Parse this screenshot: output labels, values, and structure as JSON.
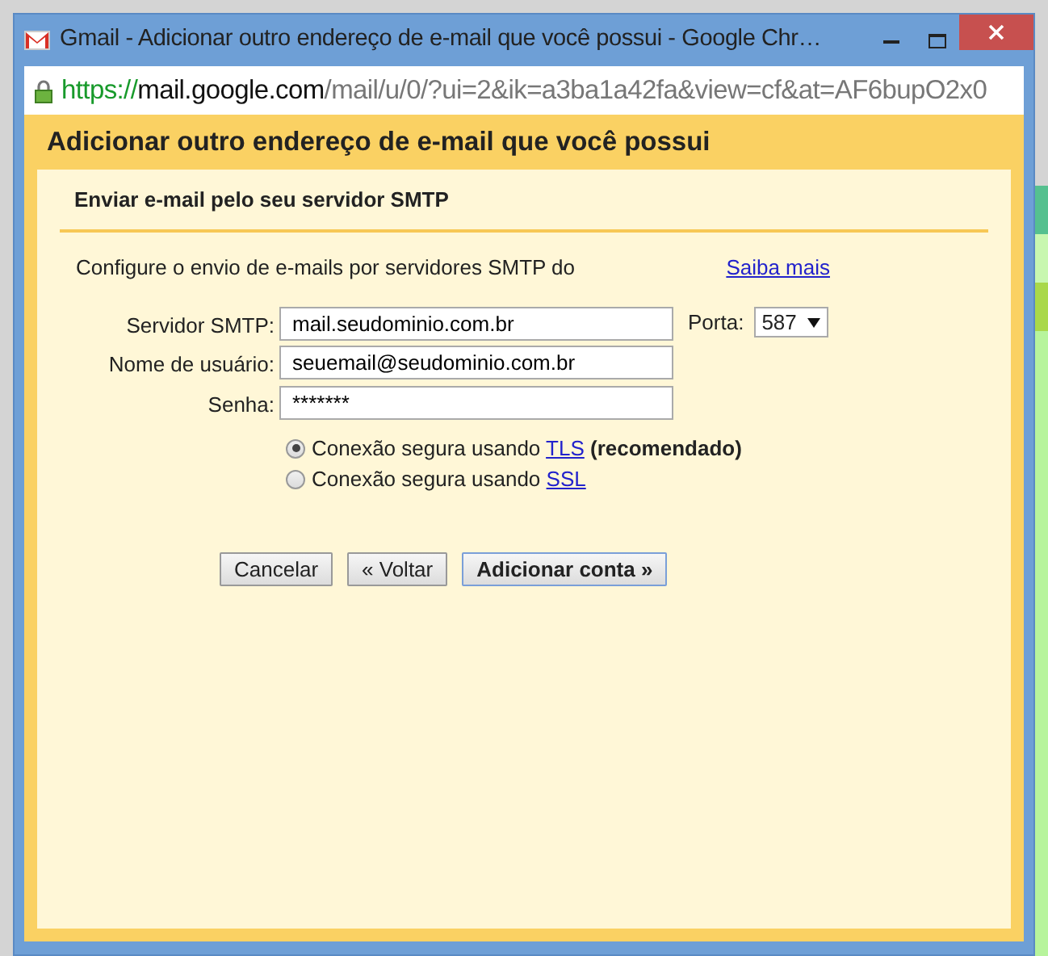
{
  "window": {
    "title": "Gmail - Adicionar outro endereço de e-mail que você possui - Google Chr…"
  },
  "address_bar": {
    "scheme": "https://",
    "host": "mail.google.com",
    "path": "/mail/u/0/?ui=2&ik=a3ba1a42fa&view=cf&at=AF6bupO2x0"
  },
  "dialog": {
    "title": "Adicionar outro endereço de e-mail que você possui",
    "section_title": "Enviar e-mail pelo seu servidor SMTP",
    "intro": "Configure o envio de e-mails por servidores SMTP do",
    "learn_more_link": "Saiba mais",
    "fields": [
      {
        "label": "Servidor SMTP:",
        "value": "mail.seudominio.com.br"
      },
      {
        "label": "Nome de usuário:",
        "value": "seuemail@seudominio.com.br"
      },
      {
        "label": "Senha:",
        "value": "*******"
      }
    ],
    "port": {
      "label": "Porta:",
      "value": "587"
    },
    "security_options": [
      {
        "text": "Conexão segura usando",
        "link": "TLS",
        "note": "(recomendado)",
        "selected": true
      },
      {
        "text": "Conexão segura usando",
        "link": "SSL",
        "selected": false
      }
    ],
    "buttons": [
      {
        "label": "Cancelar",
        "primary": false
      },
      {
        "label": "« Voltar",
        "primary": false
      },
      {
        "label": "Adicionar conta »",
        "primary": true
      }
    ]
  }
}
